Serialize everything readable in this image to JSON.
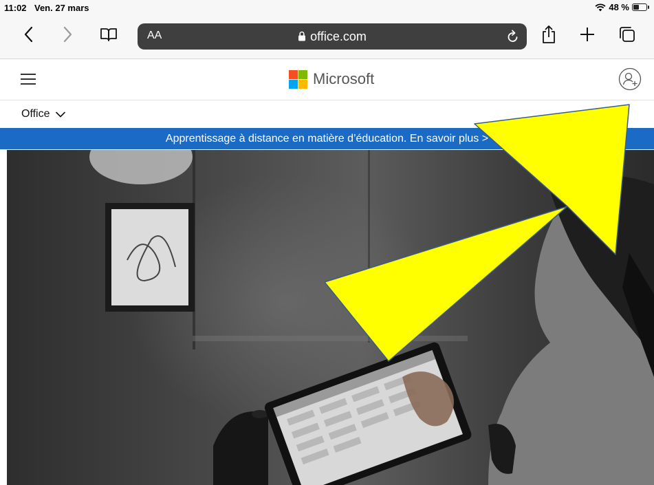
{
  "status_bar": {
    "time": "11:02",
    "date": "Ven. 27 mars",
    "battery": "48 %",
    "battery_level": 0.48
  },
  "browser": {
    "text_size_label": "AA",
    "url": "office.com",
    "icons": {
      "back": "chevron-left-icon",
      "forward": "chevron-right-icon",
      "bookmarks": "book-icon",
      "lock": "lock-icon",
      "reload": "reload-icon",
      "share": "share-icon",
      "new_tab": "plus-icon",
      "tabs": "tabs-icon"
    }
  },
  "site": {
    "brand": "Microsoft",
    "menu_icon": "hamburger-icon",
    "account_icon": "account-add-icon",
    "product_menu_label": "Office",
    "banner_text": "Apprentissage à distance en matière d’éducation. En savoir plus >"
  },
  "colors": {
    "banner_blue": "#1b6bc5",
    "annotation_yellow": "#ffff00",
    "annotation_stroke": "#3b5a8c",
    "ms_red": "#f25022",
    "ms_green": "#7fba00",
    "ms_blue": "#00a4ef",
    "ms_yellow": "#ffb900"
  }
}
